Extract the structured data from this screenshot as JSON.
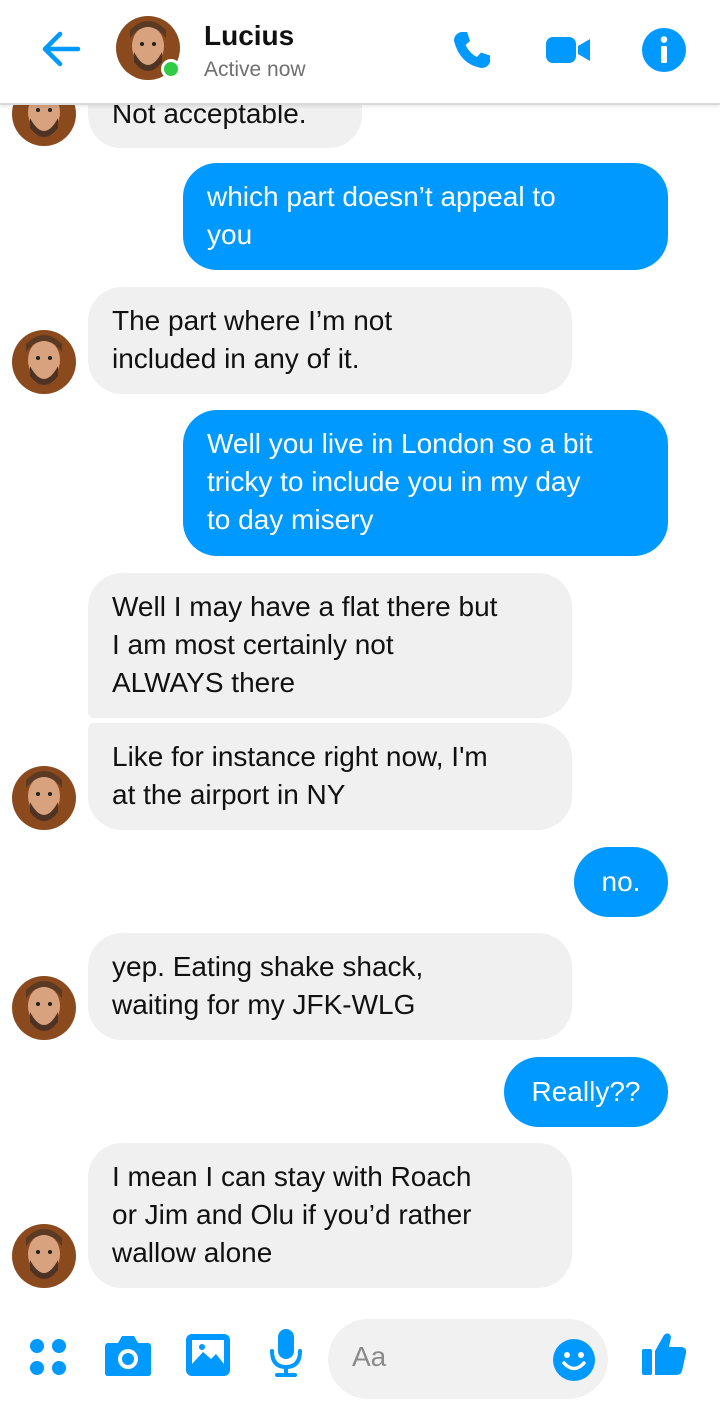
{
  "header": {
    "contact_name": "Lucius",
    "status": "Active now",
    "back_icon": "back-arrow-icon",
    "call_icon": "phone-icon",
    "video_icon": "video-camera-icon",
    "info_icon": "info-icon"
  },
  "colors": {
    "accent": "#0099ff",
    "incoming_bubble": "#f0f0f0",
    "online": "#31cc46"
  },
  "messages": [
    {
      "sender": "contact",
      "text": "Not acceptable."
    },
    {
      "sender": "me",
      "lines": [
        "which part doesn’t appeal to",
        "you"
      ]
    },
    {
      "sender": "contact",
      "lines": [
        "The part where I’m not",
        "included in any of it."
      ]
    },
    {
      "sender": "me",
      "lines": [
        "Well you live in London so a bit",
        "tricky to include you in my day",
        "to day misery"
      ]
    },
    {
      "sender": "contact",
      "lines": [
        "Well I may have a flat there but",
        "I am most certainly not",
        "ALWAYS there"
      ]
    },
    {
      "sender": "contact",
      "lines": [
        "Like for instance right now, I'm",
        "at the airport in NY"
      ]
    },
    {
      "sender": "me",
      "text": "no."
    },
    {
      "sender": "contact",
      "lines": [
        "yep.  Eating shake shack,",
        "waiting for my JFK-WLG"
      ]
    },
    {
      "sender": "me",
      "text": "Really??"
    },
    {
      "sender": "contact",
      "lines": [
        "I mean I can stay with Roach",
        "or Jim and Olu if you’d rather",
        "wallow alone"
      ]
    }
  ],
  "composer": {
    "placeholder": "Aa",
    "icons": [
      "menu-dots-icon",
      "camera-icon",
      "image-icon",
      "microphone-icon",
      "emoji-icon",
      "thumbs-up-icon"
    ]
  }
}
